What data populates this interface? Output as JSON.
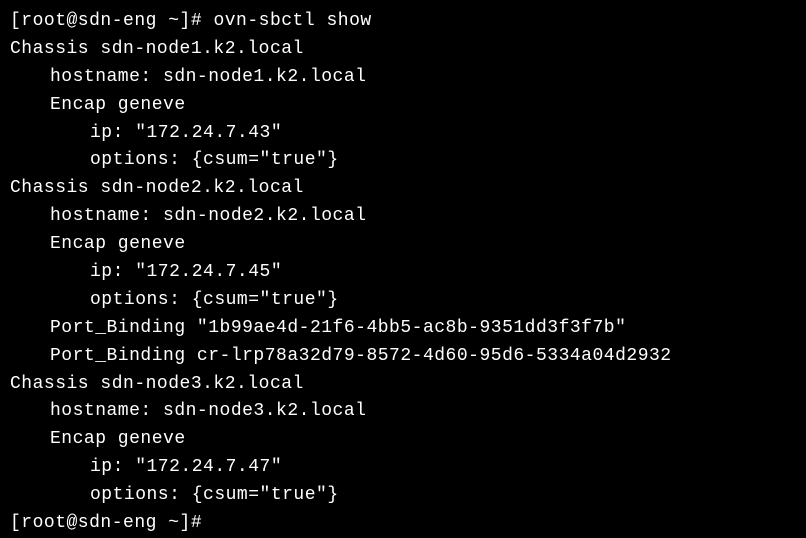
{
  "prompt1_user": "[root@sdn-eng ~]#",
  "command1": " ovn-sbctl show",
  "chassis": [
    {
      "header": "Chassis sdn-node1.k2.local",
      "hostname_line": "hostname: sdn-node1.k2.local",
      "encap_line": "Encap geneve",
      "ip_line": "ip: \"172.24.7.43\"",
      "options_line": "options: {csum=\"true\"}",
      "port_bindings": []
    },
    {
      "header": "Chassis sdn-node2.k2.local",
      "hostname_line": "hostname: sdn-node2.k2.local",
      "encap_line": "Encap geneve",
      "ip_line": "ip: \"172.24.7.45\"",
      "options_line": "options: {csum=\"true\"}",
      "port_bindings": [
        "Port_Binding \"1b99ae4d-21f6-4bb5-ac8b-9351dd3f3f7b\"",
        "Port_Binding cr-lrp78a32d79-8572-4d60-95d6-5334a04d2932"
      ]
    },
    {
      "header": "Chassis sdn-node3.k2.local",
      "hostname_line": "hostname: sdn-node3.k2.local",
      "encap_line": "Encap geneve",
      "ip_line": "ip: \"172.24.7.47\"",
      "options_line": "options: {csum=\"true\"}",
      "port_bindings": []
    }
  ],
  "prompt2": "[root@sdn-eng ~]#"
}
